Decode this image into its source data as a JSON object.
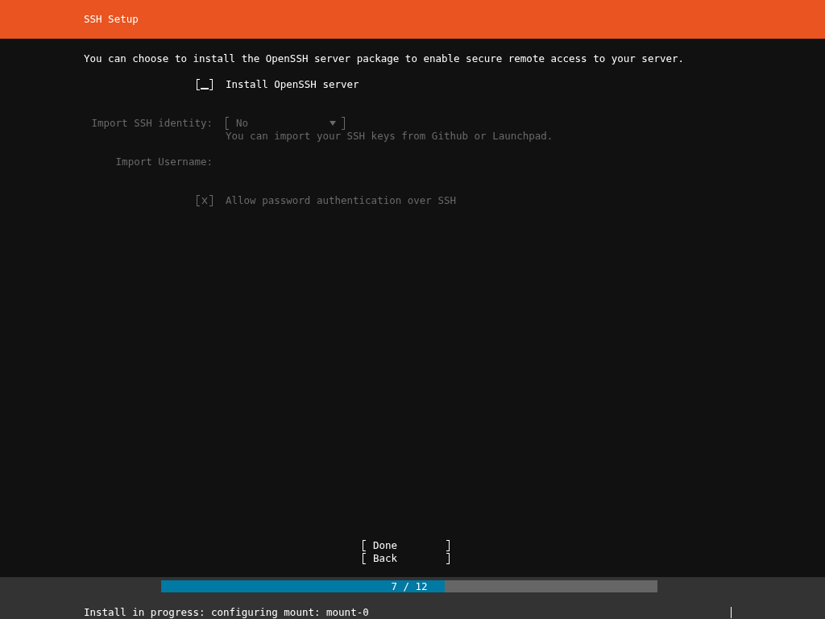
{
  "header": {
    "title": "SSH Setup"
  },
  "intro": "You can choose to install the OpenSSH server package to enable secure remote access to your server.",
  "form": [
    {
      "kind": "checkbox",
      "label": "Install OpenSSH server",
      "checked": false,
      "focused": true,
      "disabled": false
    },
    {
      "kind": "select",
      "label": "Import SSH identity:",
      "value": "No",
      "help": "You can import your SSH keys from Github or Launchpad.",
      "disabled": true
    },
    {
      "kind": "text",
      "label": "Import Username:",
      "disabled": true
    },
    {
      "kind": "checkbox",
      "label": "Allow password authentication over SSH",
      "checked": true,
      "focused": false,
      "disabled": true
    }
  ],
  "buttons": [
    "Done",
    "Back"
  ],
  "progress": {
    "level": 0.5714,
    "reading": "7 / 12"
  },
  "status_bar": {
    "text": "Install in progress: configuring mount: mount-0"
  }
}
